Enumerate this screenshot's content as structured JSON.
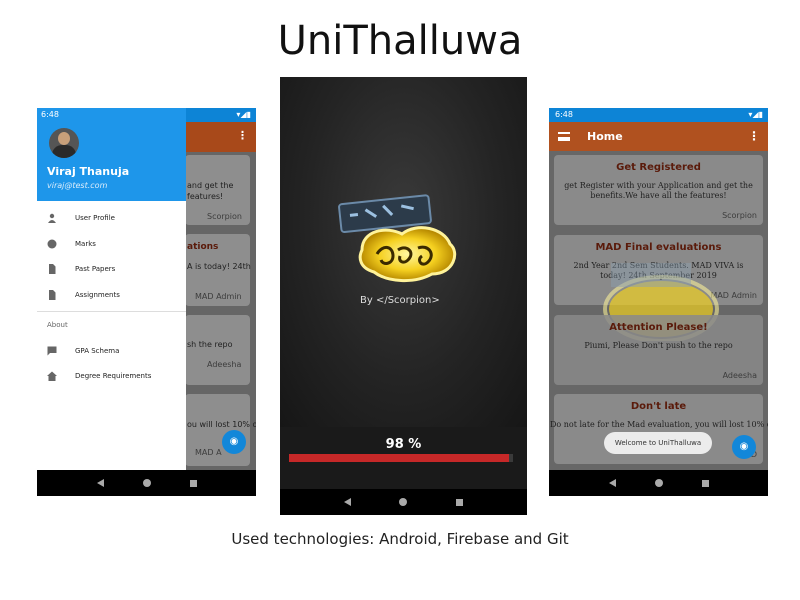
{
  "title": "UniThalluwa",
  "caption": "Used technologies: Android, Firebase and Git",
  "status_time": "6:48",
  "drawer": {
    "user_name": "Viraj Thanuja",
    "user_email": "viraj@test.com",
    "items": [
      {
        "label": "User Profile",
        "icon": "person-icon"
      },
      {
        "label": "Marks",
        "icon": "circle-icon"
      },
      {
        "label": "Past Papers",
        "icon": "document-icon"
      },
      {
        "label": "Assignments",
        "icon": "document-icon"
      }
    ],
    "section_label": "About",
    "about_items": [
      {
        "label": "GPA Schema",
        "icon": "chat-icon"
      },
      {
        "label": "Degree Requirements",
        "icon": "home-icon"
      }
    ]
  },
  "left_background": {
    "card1_text1": "and get the",
    "card1_text2": "features!",
    "card1_sig": "Scorpion",
    "card2_title": "ations",
    "card2_text": "A is today! 24th",
    "card2_sig": "MAD Admin",
    "card3_text": "sh the repo",
    "card3_sig": "Adeesha",
    "card4_text": "ou will lost 10% of",
    "card4_sig": "MAD A"
  },
  "splash": {
    "byline": "By </Scorpion>",
    "progress_label": "98 %",
    "progress_percent": 98
  },
  "home": {
    "title": "Home",
    "cards": [
      {
        "title": "Get Registered",
        "body": "get Register with your Application and get the benefits.We have all the features!",
        "sig": "Scorpion"
      },
      {
        "title": "MAD Final evaluations",
        "body": "2nd Year 2nd Sem Students. MAD VIVA is today! 24th September 2019",
        "sig": "MAD Admin"
      },
      {
        "title": "Attention Please!",
        "body": "Piumi, Please Don't push to the repo",
        "sig": "Adeesha"
      },
      {
        "title": "Don't late",
        "body": "Do not late for the Mad evaluation, you will lost 10% of",
        "sig": "MAD"
      }
    ],
    "toast": "Welcome to UniThalluwa"
  },
  "colors": {
    "accent_blue": "#1e96ea",
    "appbar_orange": "#b0511f",
    "progress_red": "#c62828",
    "card_title_brown": "#5a1a0a"
  }
}
